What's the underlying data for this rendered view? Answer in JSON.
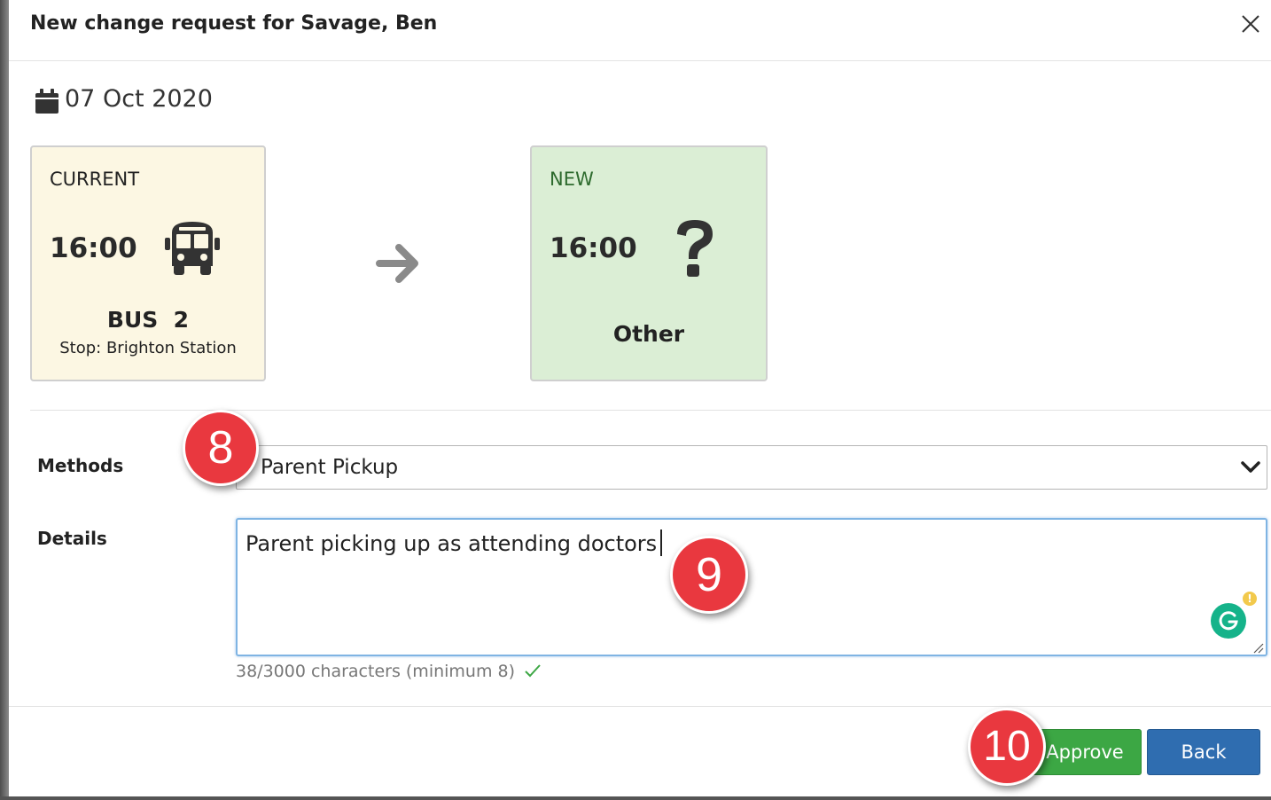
{
  "dialog": {
    "title": "New change request for Savage, Ben",
    "close_icon": "close-icon"
  },
  "date": {
    "icon": "calendar-icon",
    "text": "07 Oct 2020"
  },
  "current": {
    "label": "CURRENT",
    "time": "16:00",
    "icon": "bus-icon",
    "bus_name": "BUS  2",
    "stop": "Stop: Brighton Station"
  },
  "arrow_icon": "arrow-right-icon",
  "new": {
    "label": "NEW",
    "time": "16:00",
    "icon": "question-mark-icon",
    "method_name": "Other"
  },
  "form": {
    "methods_label": "Methods",
    "methods_value": "Parent Pickup",
    "details_label": "Details",
    "details_value": "Parent picking up as attending doctors",
    "char_count": "38/3000 characters (minimum 8)"
  },
  "buttons": {
    "approve": "Approve",
    "back": "Back"
  },
  "annotations": {
    "badge_8": "8",
    "badge_9": "9",
    "badge_10": "10"
  },
  "colors": {
    "current_card_bg": "#fcf7e3",
    "new_card_bg": "#dbeed5",
    "approve": "#3ca744",
    "back": "#2f6db0",
    "badge": "#e9383f"
  }
}
